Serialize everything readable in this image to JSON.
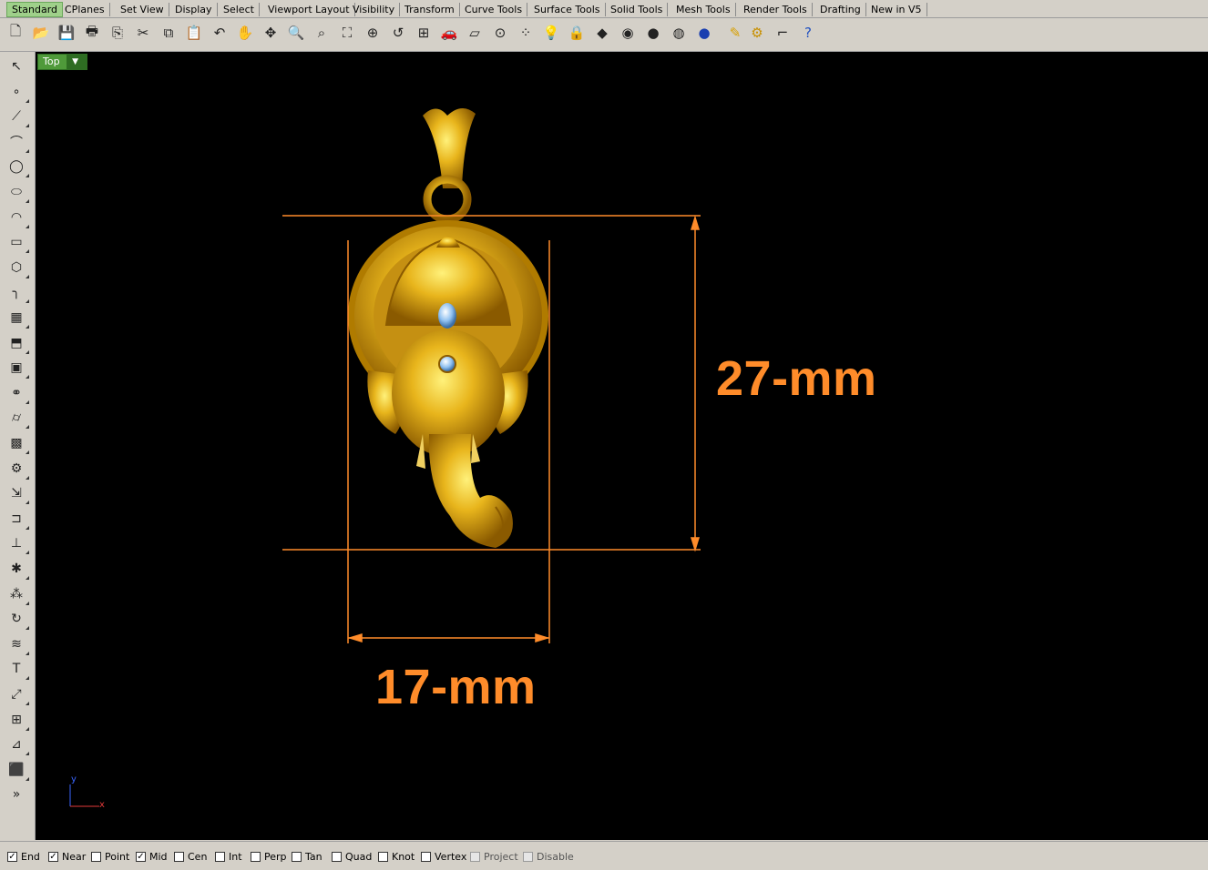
{
  "tabs": [
    "Standard",
    "CPlanes",
    "Set View",
    "Display",
    "Select",
    "Viewport Layout",
    "Visibility",
    "Transform",
    "Curve Tools",
    "Surface Tools",
    "Solid Tools",
    "Mesh Tools",
    "Render Tools",
    "Drafting",
    "New in V5"
  ],
  "active_tab": "Standard",
  "toolbar_icons": [
    "new-file-icon",
    "open-folder-icon",
    "save-icon",
    "print-icon",
    "import-icon",
    "cut-icon",
    "copy-icon",
    "paste-icon",
    "undo-icon",
    "pan-hand-icon",
    "rotate-view-icon",
    "zoom-icon",
    "zoom-window-icon",
    "zoom-extents-icon",
    "zoom-selected-icon",
    "undo-view-icon",
    "four-viewports-icon",
    "car-icon",
    "plane-icon",
    "osnap-icon",
    "points-on-icon",
    "light-icon",
    "lock-icon",
    "layer-icon",
    "color-wheel-icon",
    "shaded-sphere-icon",
    "rendered-sphere-icon",
    "blue-sphere-icon",
    "properties-icon",
    "options-gear-icon",
    "dimensions-icon",
    "help-icon"
  ],
  "left_icons": [
    "select-arrow-icon",
    "point-icon",
    "polyline-icon",
    "curve-icon",
    "circle-icon",
    "ellipse-icon",
    "arc-icon",
    "rectangle-icon",
    "polygon-icon",
    "fillet-icon",
    "surface-icon",
    "extrude-icon",
    "box-solid-icon",
    "boolean-icon",
    "cylinder-icon",
    "mesh-icon",
    "transform-gear-icon",
    "move-icon",
    "join-icon",
    "trim-icon",
    "explode-icon",
    "group-icon",
    "rotate-icon",
    "sweep-icon",
    "text-icon",
    "scale-icon",
    "array-icon",
    "edit-points-icon",
    "cube-view-icon",
    "more-icon"
  ],
  "viewport": {
    "label": "Top"
  },
  "dimensions": {
    "height": "27-mm",
    "width": "17-mm"
  },
  "axis": {
    "x": "x",
    "y": "y"
  },
  "osnaps": [
    {
      "label": "End",
      "checked": true
    },
    {
      "label": "Near",
      "checked": true
    },
    {
      "label": "Point",
      "checked": false
    },
    {
      "label": "Mid",
      "checked": true
    },
    {
      "label": "Cen",
      "checked": false
    },
    {
      "label": "Int",
      "checked": false
    },
    {
      "label": "Perp",
      "checked": false
    },
    {
      "label": "Tan",
      "checked": false
    },
    {
      "label": "Quad",
      "checked": false
    },
    {
      "label": "Knot",
      "checked": false
    },
    {
      "label": "Vertex",
      "checked": false
    },
    {
      "label": "Project",
      "checked": false,
      "disabled": true
    },
    {
      "label": "Disable",
      "checked": false,
      "disabled": true
    }
  ],
  "colors": {
    "accent_tab": "#9fd08a",
    "viewport_bg": "#000000",
    "dimension": "#ff8c2a",
    "pendant_gold": "#e0b01f"
  }
}
